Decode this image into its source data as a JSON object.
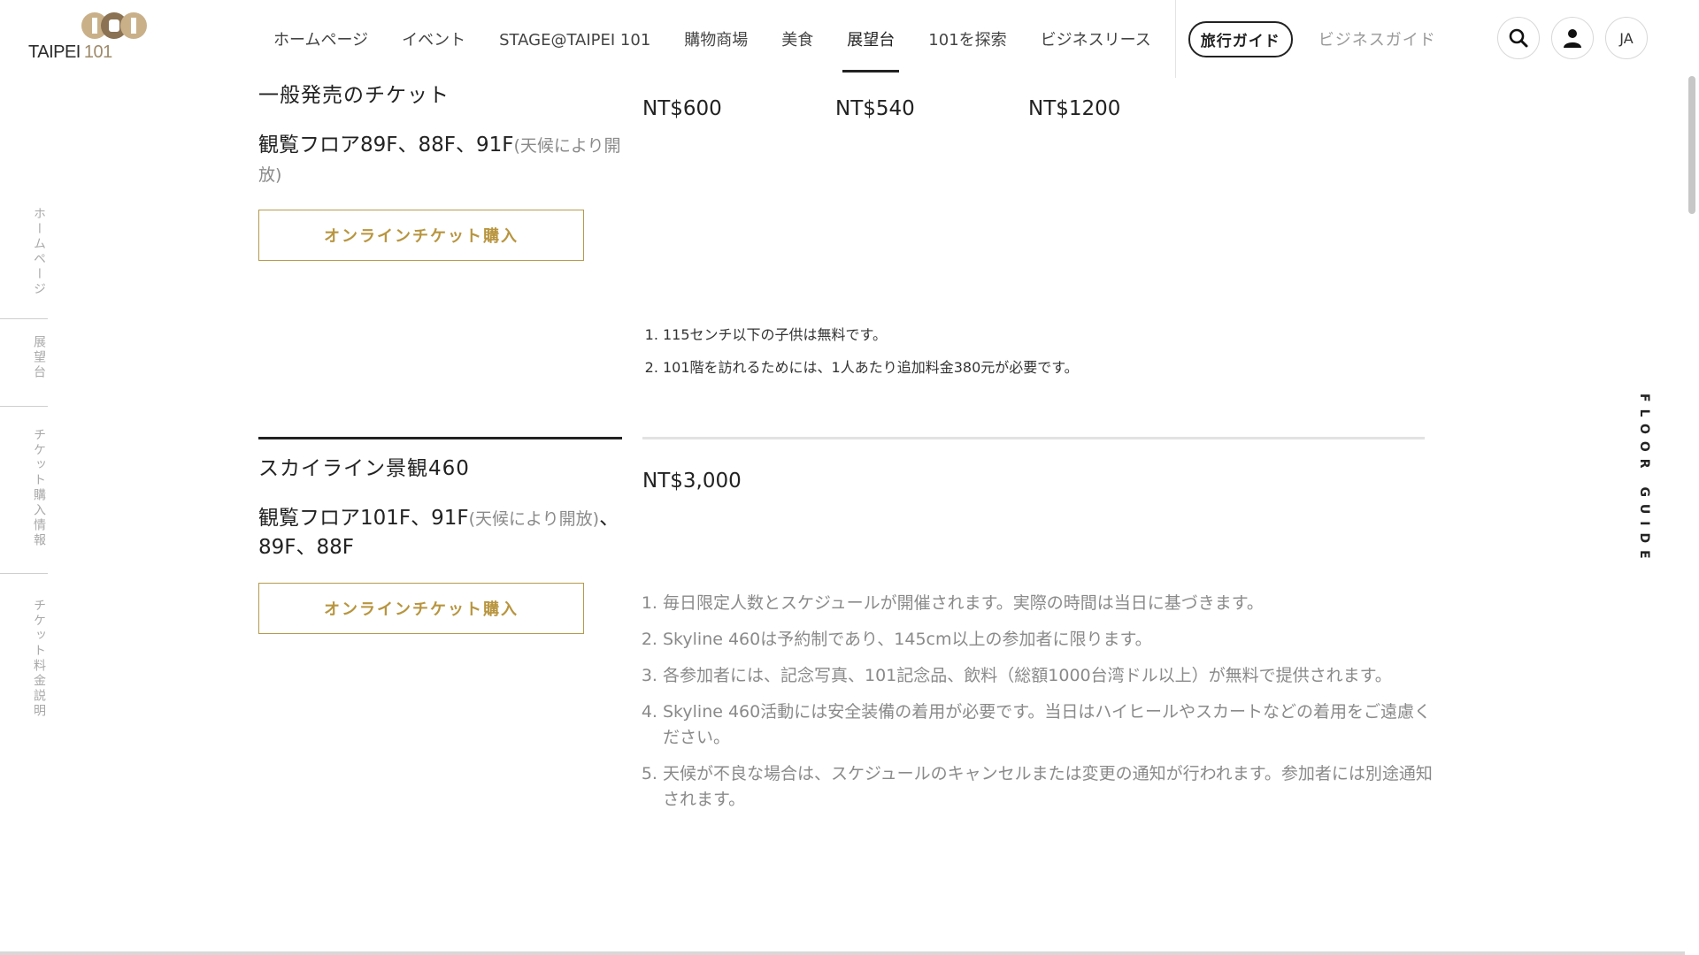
{
  "header": {
    "logo": {
      "text_main": "TAIPEI",
      "text_num": "101"
    },
    "nav": [
      {
        "label": "ホームページ"
      },
      {
        "label": "イベント"
      },
      {
        "label": "STAGE@TAIPEI 101"
      },
      {
        "label": "購物商場"
      },
      {
        "label": "美食"
      },
      {
        "label": "展望台"
      },
      {
        "label": "101を探索"
      },
      {
        "label": "ビジネスリース"
      }
    ],
    "active_nav": "展望台",
    "travel_guide": "旅行ガイド",
    "business_guide": "ビジネスガイド",
    "language": "JA"
  },
  "sidenav": [
    {
      "label": "ホームページ"
    },
    {
      "label": "展望台"
    },
    {
      "label": "チケット購入情報"
    },
    {
      "label": "チケット料金説明"
    }
  ],
  "floor_guide": "FLOOR GUIDE",
  "sections": {
    "general": {
      "title": "一般発売のチケット",
      "floor": "観覧フロア89F、88F、91F",
      "floor_note": "(天候により開放)",
      "prices": [
        "NT$600",
        "NT$540",
        "NT$1200"
      ],
      "button": "オンラインチケット購入",
      "notes": [
        "115センチ以下の子供は無料です。",
        "101階を訪れるためには、1人あたり追加料金380元が必要です。"
      ]
    },
    "skyline": {
      "title": "スカイライン景観460",
      "floor": "観覧フロア101F、91F",
      "floor_note": "(天候により開放)",
      "floor_rest": "、89F、88F",
      "price": "NT$3,000",
      "button": "オンラインチケット購入",
      "notes": [
        "毎日限定人数とスケジュールが開催されます。実際の時間は当日に基づきます。",
        "Skyline 460は予約制であり、145cm以上の参加者に限ります。",
        "各参加者には、記念写真、101記念品、飲料（総額1000台湾ドル以上）が無料で提供されます。",
        "Skyline 460活動には安全装備の着用が必要です。当日はハイヒールやスカートなどの着用をご遠慮ください。",
        "天候が不良な場合は、スケジュールのキャンセルまたは変更の通知が行われます。参加者には別途通知されます。"
      ]
    }
  }
}
